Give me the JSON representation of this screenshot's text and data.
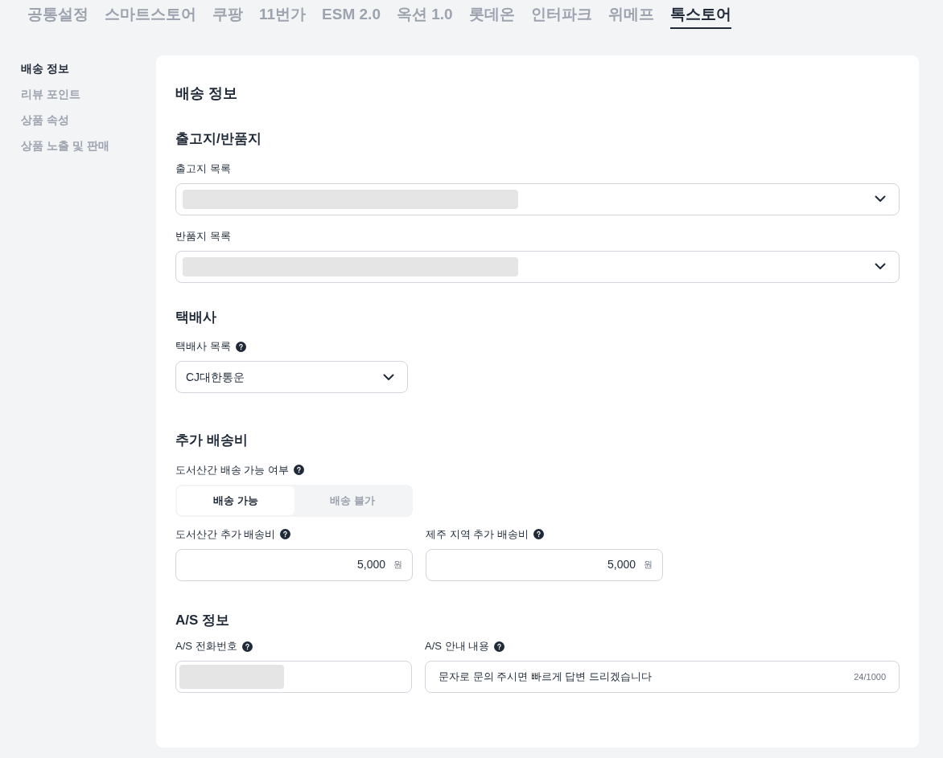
{
  "tabs": [
    {
      "label": "공통설정",
      "selected": false
    },
    {
      "label": "스마트스토어",
      "selected": false
    },
    {
      "label": "쿠팡",
      "selected": false
    },
    {
      "label": "11번가",
      "selected": false
    },
    {
      "label": "ESM 2.0",
      "selected": false
    },
    {
      "label": "옥션 1.0",
      "selected": false
    },
    {
      "label": "롯데온",
      "selected": false
    },
    {
      "label": "인터파크",
      "selected": false
    },
    {
      "label": "위메프",
      "selected": false
    },
    {
      "label": "톡스토어",
      "selected": true
    }
  ],
  "sidebar": {
    "items": [
      {
        "label": "배송 정보",
        "selected": true
      },
      {
        "label": "리뷰 포인트",
        "selected": false
      },
      {
        "label": "상품 속성",
        "selected": false
      },
      {
        "label": "상품 노출 및 판매",
        "selected": false
      }
    ]
  },
  "title": "배송 정보",
  "origin": {
    "heading": "출고지/반품지",
    "shipping_label": "출고지 목록",
    "return_label": "반품지 목록"
  },
  "courier": {
    "heading": "택배사",
    "label": "택배사 목록",
    "value": "CJ대한통운"
  },
  "extra": {
    "heading": "추가 배송비",
    "toggle_label": "도서산간 배송 가능 여부",
    "options": [
      {
        "label": "배송 가능",
        "selected": true
      },
      {
        "label": "배송 불가",
        "selected": false
      }
    ],
    "fees": [
      {
        "label": "도서산간 추가 배송비",
        "value": "5,000",
        "unit": "원"
      },
      {
        "label": "제주 지역 추가 배송비",
        "value": "5,000",
        "unit": "원"
      }
    ]
  },
  "as": {
    "heading": "A/S 정보",
    "phone_label": "A/S 전화번호",
    "guide_label": "A/S 안내 내용",
    "guide_value": "문자로 문의 주시면 빠르게 답변 드리겠습니다",
    "counter": "24/1000"
  }
}
